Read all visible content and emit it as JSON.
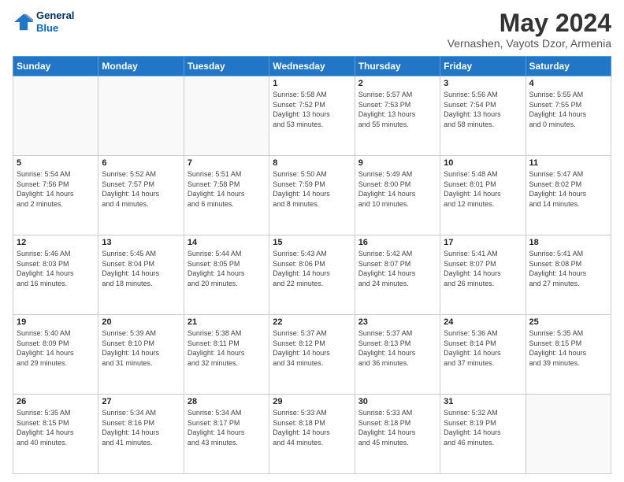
{
  "header": {
    "logo_line1": "General",
    "logo_line2": "Blue",
    "title": "May 2024",
    "subtitle": "Vernashen, Vayots Dzor, Armenia"
  },
  "calendar": {
    "headers": [
      "Sunday",
      "Monday",
      "Tuesday",
      "Wednesday",
      "Thursday",
      "Friday",
      "Saturday"
    ],
    "rows": [
      [
        {
          "day": "",
          "info": ""
        },
        {
          "day": "",
          "info": ""
        },
        {
          "day": "",
          "info": ""
        },
        {
          "day": "1",
          "info": "Sunrise: 5:58 AM\nSunset: 7:52 PM\nDaylight: 13 hours\nand 53 minutes."
        },
        {
          "day": "2",
          "info": "Sunrise: 5:57 AM\nSunset: 7:53 PM\nDaylight: 13 hours\nand 55 minutes."
        },
        {
          "day": "3",
          "info": "Sunrise: 5:56 AM\nSunset: 7:54 PM\nDaylight: 13 hours\nand 58 minutes."
        },
        {
          "day": "4",
          "info": "Sunrise: 5:55 AM\nSunset: 7:55 PM\nDaylight: 14 hours\nand 0 minutes."
        }
      ],
      [
        {
          "day": "5",
          "info": "Sunrise: 5:54 AM\nSunset: 7:56 PM\nDaylight: 14 hours\nand 2 minutes."
        },
        {
          "day": "6",
          "info": "Sunrise: 5:52 AM\nSunset: 7:57 PM\nDaylight: 14 hours\nand 4 minutes."
        },
        {
          "day": "7",
          "info": "Sunrise: 5:51 AM\nSunset: 7:58 PM\nDaylight: 14 hours\nand 6 minutes."
        },
        {
          "day": "8",
          "info": "Sunrise: 5:50 AM\nSunset: 7:59 PM\nDaylight: 14 hours\nand 8 minutes."
        },
        {
          "day": "9",
          "info": "Sunrise: 5:49 AM\nSunset: 8:00 PM\nDaylight: 14 hours\nand 10 minutes."
        },
        {
          "day": "10",
          "info": "Sunrise: 5:48 AM\nSunset: 8:01 PM\nDaylight: 14 hours\nand 12 minutes."
        },
        {
          "day": "11",
          "info": "Sunrise: 5:47 AM\nSunset: 8:02 PM\nDaylight: 14 hours\nand 14 minutes."
        }
      ],
      [
        {
          "day": "12",
          "info": "Sunrise: 5:46 AM\nSunset: 8:03 PM\nDaylight: 14 hours\nand 16 minutes."
        },
        {
          "day": "13",
          "info": "Sunrise: 5:45 AM\nSunset: 8:04 PM\nDaylight: 14 hours\nand 18 minutes."
        },
        {
          "day": "14",
          "info": "Sunrise: 5:44 AM\nSunset: 8:05 PM\nDaylight: 14 hours\nand 20 minutes."
        },
        {
          "day": "15",
          "info": "Sunrise: 5:43 AM\nSunset: 8:06 PM\nDaylight: 14 hours\nand 22 minutes."
        },
        {
          "day": "16",
          "info": "Sunrise: 5:42 AM\nSunset: 8:07 PM\nDaylight: 14 hours\nand 24 minutes."
        },
        {
          "day": "17",
          "info": "Sunrise: 5:41 AM\nSunset: 8:07 PM\nDaylight: 14 hours\nand 26 minutes."
        },
        {
          "day": "18",
          "info": "Sunrise: 5:41 AM\nSunset: 8:08 PM\nDaylight: 14 hours\nand 27 minutes."
        }
      ],
      [
        {
          "day": "19",
          "info": "Sunrise: 5:40 AM\nSunset: 8:09 PM\nDaylight: 14 hours\nand 29 minutes."
        },
        {
          "day": "20",
          "info": "Sunrise: 5:39 AM\nSunset: 8:10 PM\nDaylight: 14 hours\nand 31 minutes."
        },
        {
          "day": "21",
          "info": "Sunrise: 5:38 AM\nSunset: 8:11 PM\nDaylight: 14 hours\nand 32 minutes."
        },
        {
          "day": "22",
          "info": "Sunrise: 5:37 AM\nSunset: 8:12 PM\nDaylight: 14 hours\nand 34 minutes."
        },
        {
          "day": "23",
          "info": "Sunrise: 5:37 AM\nSunset: 8:13 PM\nDaylight: 14 hours\nand 36 minutes."
        },
        {
          "day": "24",
          "info": "Sunrise: 5:36 AM\nSunset: 8:14 PM\nDaylight: 14 hours\nand 37 minutes."
        },
        {
          "day": "25",
          "info": "Sunrise: 5:35 AM\nSunset: 8:15 PM\nDaylight: 14 hours\nand 39 minutes."
        }
      ],
      [
        {
          "day": "26",
          "info": "Sunrise: 5:35 AM\nSunset: 8:15 PM\nDaylight: 14 hours\nand 40 minutes."
        },
        {
          "day": "27",
          "info": "Sunrise: 5:34 AM\nSunset: 8:16 PM\nDaylight: 14 hours\nand 41 minutes."
        },
        {
          "day": "28",
          "info": "Sunrise: 5:34 AM\nSunset: 8:17 PM\nDaylight: 14 hours\nand 43 minutes."
        },
        {
          "day": "29",
          "info": "Sunrise: 5:33 AM\nSunset: 8:18 PM\nDaylight: 14 hours\nand 44 minutes."
        },
        {
          "day": "30",
          "info": "Sunrise: 5:33 AM\nSunset: 8:18 PM\nDaylight: 14 hours\nand 45 minutes."
        },
        {
          "day": "31",
          "info": "Sunrise: 5:32 AM\nSunset: 8:19 PM\nDaylight: 14 hours\nand 46 minutes."
        },
        {
          "day": "",
          "info": ""
        }
      ]
    ]
  }
}
